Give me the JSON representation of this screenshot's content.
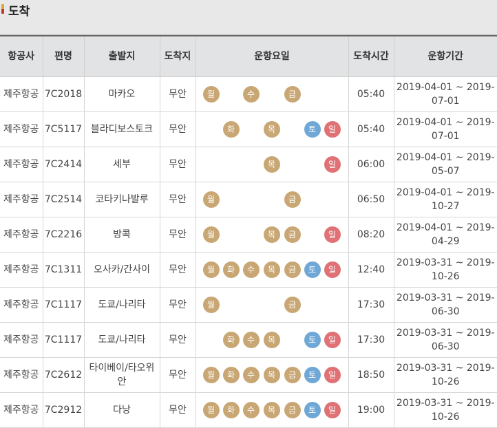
{
  "page_title": "도착",
  "colors": {
    "weekday": "#c9a774",
    "saturday": "#6fa8d6",
    "sunday": "#e07175"
  },
  "headers": [
    "항공사",
    "편명",
    "출발지",
    "도착지",
    "운항요일",
    "도착시간",
    "운항기간"
  ],
  "day_labels": [
    "월",
    "화",
    "수",
    "목",
    "금",
    "토",
    "일"
  ],
  "rows": [
    {
      "airline": "제주항공",
      "flight": "7C2018",
      "origin": "마카오",
      "dest": "무안",
      "days": [
        "월",
        "수",
        "금"
      ],
      "time": "05:40",
      "period": "2019-04-01 ~ 2019-07-01"
    },
    {
      "airline": "제주항공",
      "flight": "7C5117",
      "origin": "블라디보스토크",
      "dest": "무안",
      "days": [
        "화",
        "목",
        "토",
        "일"
      ],
      "time": "05:40",
      "period": "2019-04-01 ~ 2019-07-01"
    },
    {
      "airline": "제주항공",
      "flight": "7C2414",
      "origin": "세부",
      "dest": "무안",
      "days": [
        "목",
        "일"
      ],
      "time": "06:00",
      "period": "2019-04-01 ~ 2019-05-07"
    },
    {
      "airline": "제주항공",
      "flight": "7C2514",
      "origin": "코타키나발루",
      "dest": "무안",
      "days": [
        "월",
        "금"
      ],
      "time": "06:50",
      "period": "2019-04-01 ~ 2019-10-27"
    },
    {
      "airline": "제주항공",
      "flight": "7C2216",
      "origin": "방콕",
      "dest": "무안",
      "days": [
        "월",
        "목",
        "금",
        "일"
      ],
      "time": "08:20",
      "period": "2019-04-01 ~ 2019-04-29"
    },
    {
      "airline": "제주항공",
      "flight": "7C1311",
      "origin": "오사카/간사이",
      "dest": "무안",
      "days": [
        "월",
        "화",
        "수",
        "목",
        "금",
        "토",
        "일"
      ],
      "time": "12:40",
      "period": "2019-03-31 ~ 2019-10-26"
    },
    {
      "airline": "제주항공",
      "flight": "7C1117",
      "origin": "도쿄/나리타",
      "dest": "무안",
      "days": [
        "월",
        "금"
      ],
      "time": "17:30",
      "period": "2019-03-31 ~ 2019-06-30"
    },
    {
      "airline": "제주항공",
      "flight": "7C1117",
      "origin": "도쿄/나리타",
      "dest": "무안",
      "days": [
        "화",
        "수",
        "목",
        "토",
        "일"
      ],
      "time": "17:30",
      "period": "2019-03-31 ~ 2019-06-30"
    },
    {
      "airline": "제주항공",
      "flight": "7C2612",
      "origin": "타이베이/타오위안",
      "dest": "무안",
      "days": [
        "월",
        "화",
        "수",
        "목",
        "금",
        "토",
        "일"
      ],
      "time": "18:50",
      "period": "2019-03-31 ~ 2019-10-26"
    },
    {
      "airline": "제주항공",
      "flight": "7C2912",
      "origin": "다낭",
      "dest": "무안",
      "days": [
        "월",
        "화",
        "수",
        "목",
        "금",
        "토",
        "일"
      ],
      "time": "19:00",
      "period": "2019-03-31 ~ 2019-10-26"
    }
  ]
}
